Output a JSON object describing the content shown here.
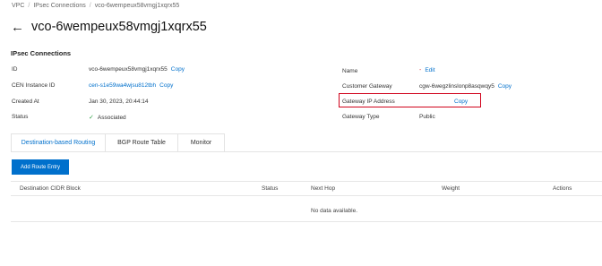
{
  "breadcrumb": [
    "VPC",
    "IPsec Connections",
    "vco-6wempeux58vmgj1xqrx55"
  ],
  "header": {
    "back_icon": "←",
    "title": "vco-6wempeux58vmgj1xqrx55"
  },
  "section_title": "IPsec Connections",
  "details": {
    "id_label": "ID",
    "id_value": "vco-6wempeux58vmgj1xqrx55",
    "id_copy": "Copy",
    "cen_label": "CEN Instance ID",
    "cen_value": "cen-s1e59wa4wjsu812tbh",
    "cen_copy": "Copy",
    "created_label": "Created At",
    "created_value": "Jan 30, 2023, 20:44:14",
    "status_label": "Status",
    "status_icon": "✓",
    "status_value": "Associated",
    "name_label": "Name",
    "name_value": "-",
    "name_edit": "Edit",
    "cg_label": "Customer Gateway",
    "cg_value": "cgw-6wegzlinslonp8asqwqy5",
    "cg_copy": "Copy",
    "gip_label": "Gateway IP Address",
    "gip_copy": "Copy",
    "gt_label": "Gateway Type",
    "gt_value": "Public"
  },
  "tabs": [
    "Destination-based Routing",
    "BGP Route Table",
    "Monitor"
  ],
  "add_button": "Add Route Entry",
  "table": {
    "columns": [
      "Destination CIDR Block",
      "Status",
      "Next Hop",
      "Weight",
      "Actions"
    ],
    "empty": "No data available."
  },
  "colors": {
    "accent": "#0070cc",
    "highlight_box": "#d0021b",
    "success": "#2e9e44"
  }
}
